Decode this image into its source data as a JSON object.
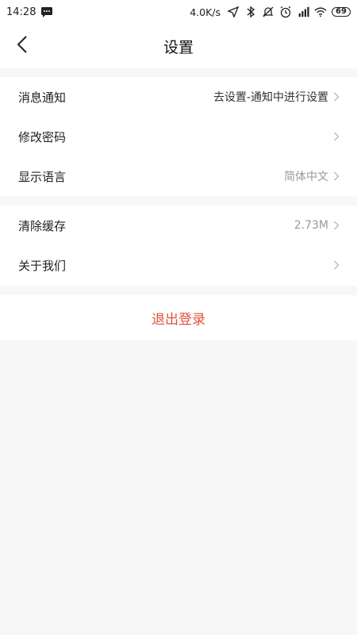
{
  "status_bar": {
    "time": "14:28",
    "net_speed": "4.0K/s",
    "battery": "69"
  },
  "header": {
    "title": "设置"
  },
  "groups": [
    {
      "items": [
        {
          "label": "消息通知",
          "value": "去设置-通知中进行设置"
        },
        {
          "label": "修改密码",
          "value": ""
        },
        {
          "label": "显示语言",
          "value": "简体中文"
        }
      ]
    },
    {
      "items": [
        {
          "label": "清除缓存",
          "value": "2.73M"
        },
        {
          "label": "关于我们",
          "value": ""
        }
      ]
    }
  ],
  "logout_label": "退出登录",
  "colors": {
    "accent": "#e2513a",
    "background": "#f7f7f7",
    "card": "#ffffff"
  }
}
